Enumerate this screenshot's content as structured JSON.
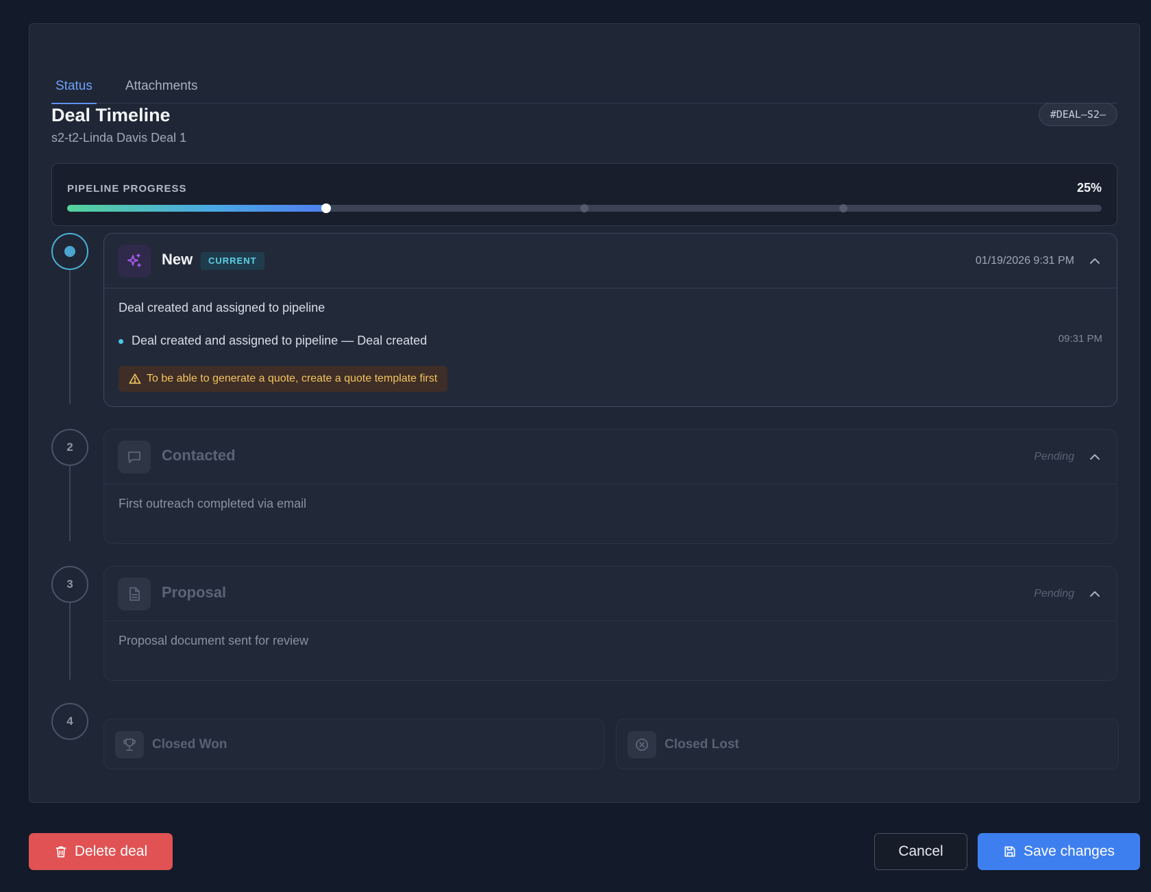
{
  "tabs": [
    {
      "label": "Status",
      "active": true
    },
    {
      "label": "Attachments",
      "active": false
    }
  ],
  "deal": {
    "title": "Deal Timeline",
    "subtitle": "s2-t2-Linda Davis Deal 1",
    "id_badge": "#DEAL–S2–"
  },
  "progress": {
    "label": "PIPELINE PROGRESS",
    "percent_text": "25%",
    "completed_stages": 1,
    "total_stages": 4
  },
  "stages": [
    {
      "number": "1",
      "name": "New",
      "badge": "CURRENT",
      "date": "01/19/2026 9:31 PM",
      "icon": "sparkles-icon",
      "description": "Deal created and assigned to pipeline",
      "event_text": "Deal created and assigned to pipeline — Deal created",
      "event_time": "09:31 PM",
      "warning": "To be able to generate a quote, create a quote template first",
      "status": "current"
    },
    {
      "number": "2",
      "name": "Contacted",
      "status_label": "Pending",
      "icon": "message-icon",
      "description": "First outreach completed via email",
      "status": "pending"
    },
    {
      "number": "3",
      "name": "Proposal",
      "status_label": "Pending",
      "icon": "document-icon",
      "description": "Proposal document sent for review",
      "status": "pending"
    },
    {
      "number": "4",
      "outcomes": [
        {
          "label": "Closed Won",
          "icon": "trophy-icon"
        },
        {
          "label": "Closed Lost",
          "icon": "x-circle-icon"
        }
      ],
      "status": "pending"
    }
  ],
  "actions": {
    "delete": "Delete deal",
    "cancel": "Cancel",
    "save": "Save changes"
  },
  "colors": {
    "accent": "#3e7ff0",
    "danger": "#e05253",
    "current_badge": "#5ed0e8",
    "warning_text": "#f4c560"
  }
}
